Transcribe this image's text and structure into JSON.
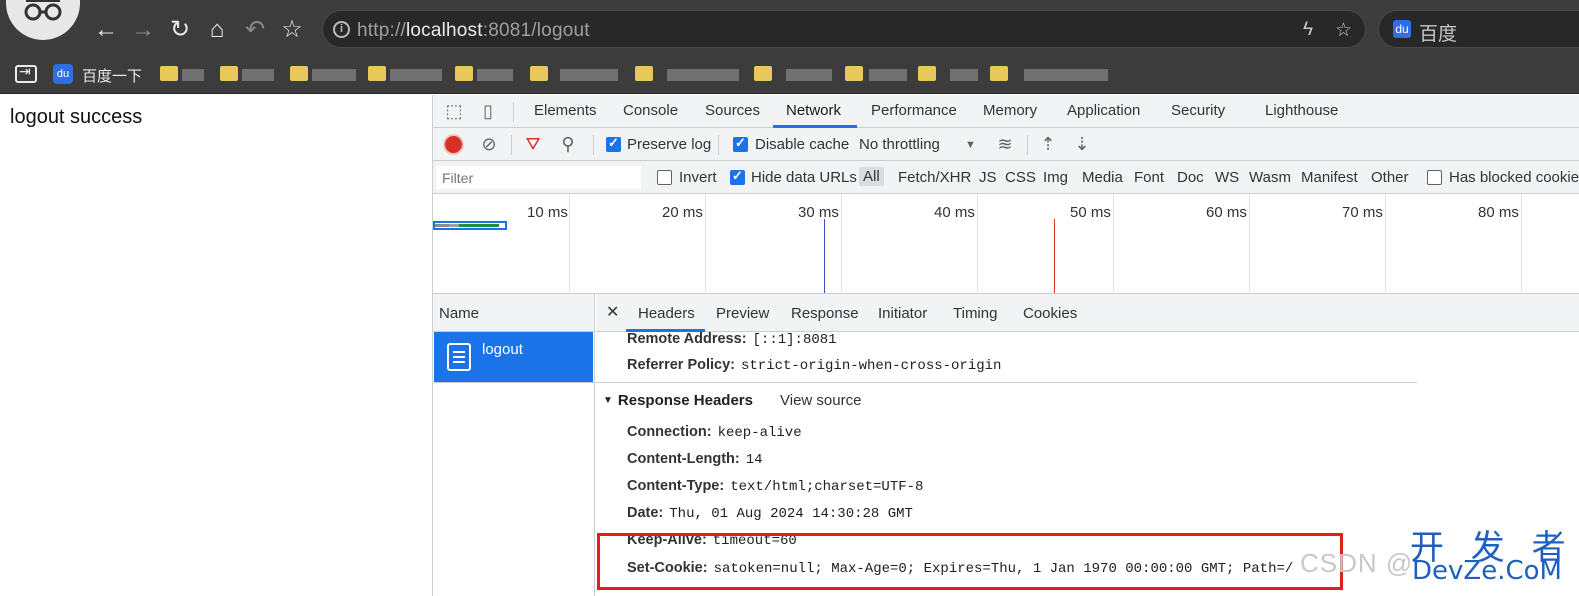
{
  "browser": {
    "url_scheme": "http://",
    "url_host": "localhost",
    "url_rest": ":8081/logout",
    "search_engine": "百度",
    "bookmark_label": "百度一下"
  },
  "page": {
    "text": "logout success"
  },
  "devtools": {
    "tabs": [
      "Elements",
      "Console",
      "Sources",
      "Network",
      "Performance",
      "Memory",
      "Application",
      "Security",
      "Lighthouse"
    ],
    "active_tab": "Network",
    "toolbar": {
      "preserve_log": "Preserve log",
      "disable_cache": "Disable cache",
      "throttling": "No throttling"
    },
    "filter": {
      "placeholder": "Filter",
      "invert": "Invert",
      "hide_data_urls": "Hide data URLs",
      "types": [
        "All",
        "Fetch/XHR",
        "JS",
        "CSS",
        "Img",
        "Media",
        "Font",
        "Doc",
        "WS",
        "Wasm",
        "Manifest",
        "Other"
      ],
      "has_blocked": "Has blocked cookies"
    },
    "timeline": [
      "10 ms",
      "20 ms",
      "30 ms",
      "40 ms",
      "50 ms",
      "60 ms",
      "70 ms",
      "80 ms"
    ],
    "request_list": {
      "header": "Name",
      "items": [
        "logout"
      ]
    },
    "details": {
      "tabs": [
        "Headers",
        "Preview",
        "Response",
        "Initiator",
        "Timing",
        "Cookies"
      ],
      "active_tab": "Headers",
      "general": [
        {
          "k": "Remote Address:",
          "v": "[::1]:8081"
        },
        {
          "k": "Referrer Policy:",
          "v": "strict-origin-when-cross-origin"
        }
      ],
      "response_headers_title": "Response Headers",
      "view_source": "View source",
      "response_headers": [
        {
          "k": "Connection:",
          "v": "keep-alive"
        },
        {
          "k": "Content-Length:",
          "v": "14"
        },
        {
          "k": "Content-Type:",
          "v": "text/html;charset=UTF-8"
        },
        {
          "k": "Date:",
          "v": "Thu, 01 Aug 2024 14:30:28 GMT"
        },
        {
          "k": "Keep-Alive:",
          "v": "timeout=60"
        },
        {
          "k": "Set-Cookie:",
          "v": "satoken=null; Max-Age=0; Expires=Thu, 1 Jan 1970 00:00:00 GMT; Path=/"
        }
      ]
    }
  },
  "watermark": {
    "csdn": "CSDN @",
    "devze_cn": "开 发 者",
    "devze": "DevZe.CoM"
  },
  "colors": {
    "accent": "#1a73e8",
    "highlight": "#e0201a",
    "chrome_dark": "#3c3c3c"
  }
}
